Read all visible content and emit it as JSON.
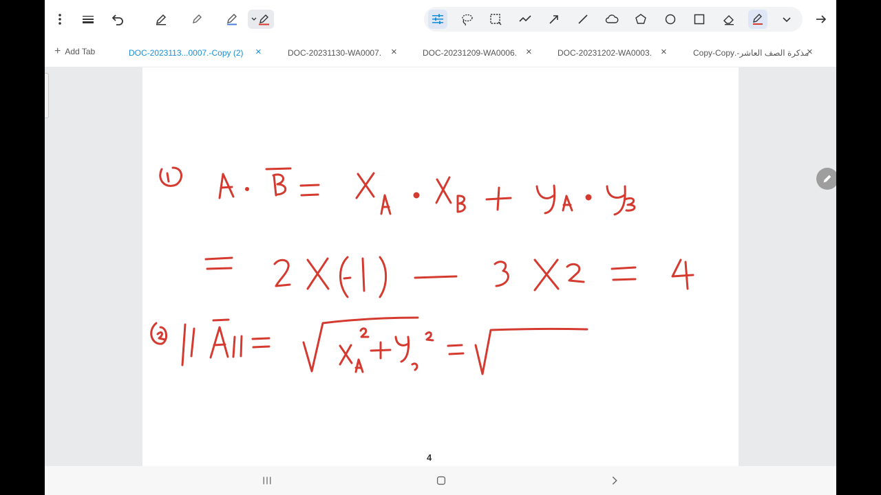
{
  "tabs": {
    "add_tab_label": "Add Tab",
    "items": [
      {
        "label": "DOC-2023113...0007.-Copy (2)",
        "active": true
      },
      {
        "label": "DOC-20231130-WA0007.",
        "active": false
      },
      {
        "label": "DOC-20231209-WA0006.",
        "active": false
      },
      {
        "label": "DOC-20231202-WA0003.",
        "active": false
      },
      {
        "label": "مذكرة الصف العاشر-.Copy-Copy",
        "active": false
      }
    ],
    "close_glyph": "×"
  },
  "toolbar": {
    "left_tools": [
      "more-icon",
      "line-thickness-icon",
      "undo-icon",
      "pen-icon",
      "pencil-icon",
      "highlighter-icon",
      "pen-color-dropdown-icon"
    ],
    "shape_tools": [
      "adjust-icon",
      "lasso-icon",
      "select-rect-icon",
      "freehand-line-icon",
      "arrow-icon",
      "line-icon",
      "cloud-icon",
      "pentagon-icon",
      "circle-icon",
      "square-icon",
      "eraser-icon",
      "red-pen-icon",
      "chevron-down-icon"
    ],
    "accent_color": "#1a8fd6",
    "ink_color": "#d43a2f"
  },
  "page": {
    "number": "4"
  },
  "navbar": {
    "buttons": [
      "recents-icon",
      "home-icon",
      "back-icon"
    ]
  }
}
